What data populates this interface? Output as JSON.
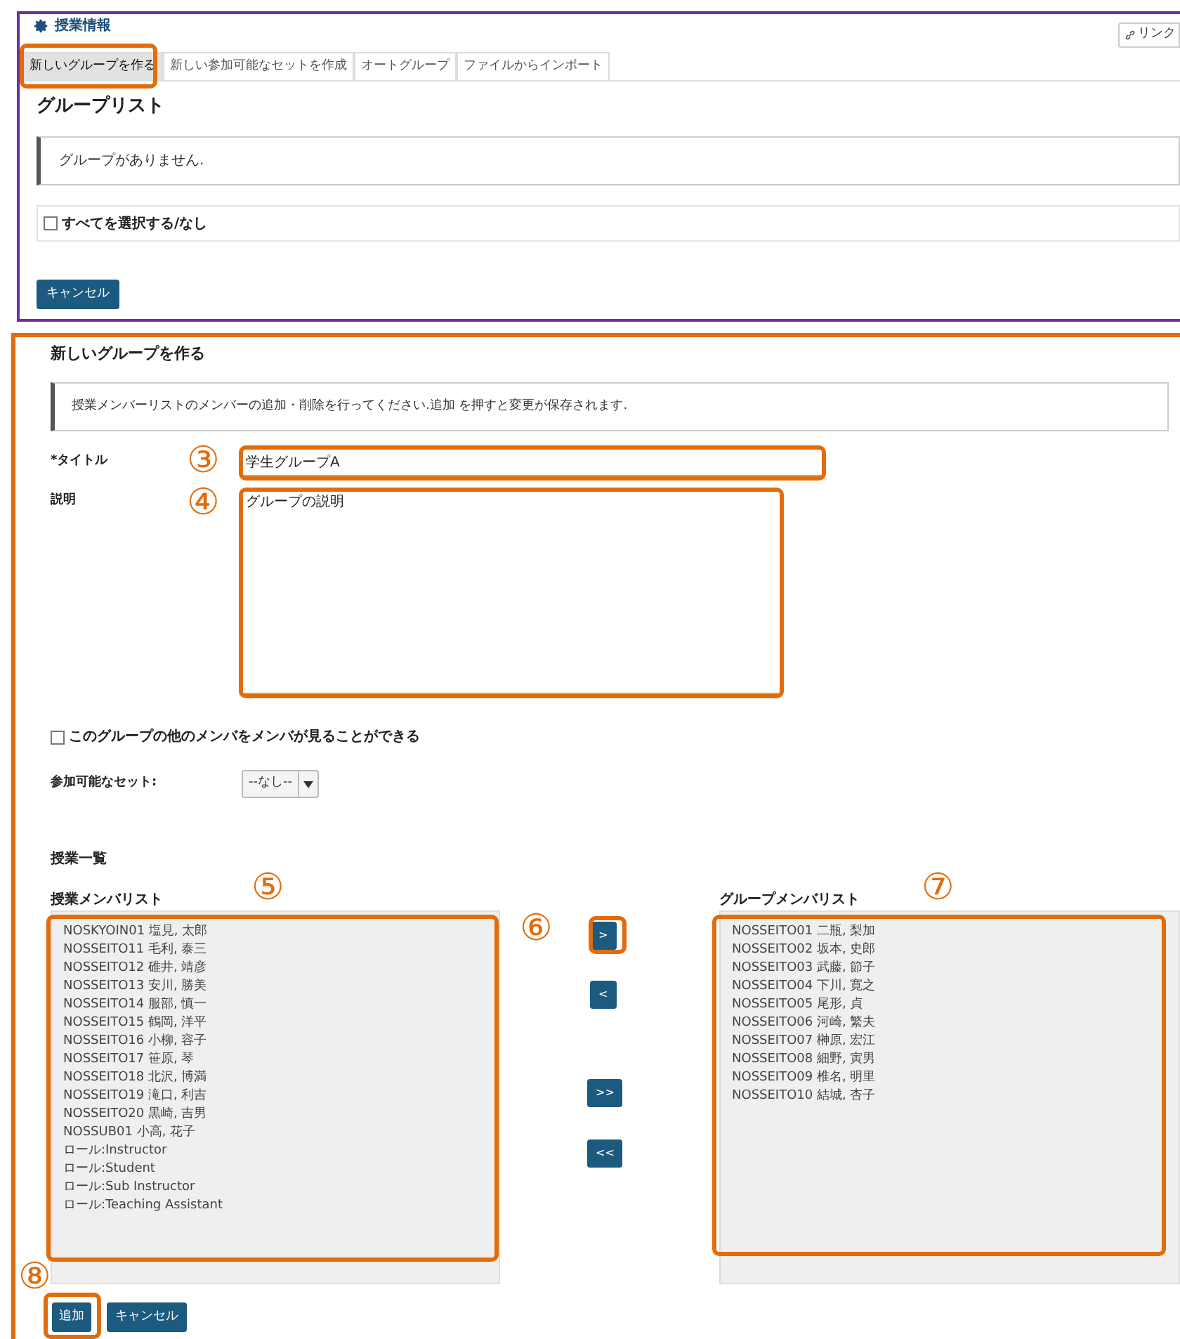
{
  "header": {
    "title": "授業情報",
    "link_button": "リンク"
  },
  "tabs": [
    {
      "label": "新しいグループを作る",
      "selected": true
    },
    {
      "label": "新しい参加可能なセットを作成",
      "selected": false
    },
    {
      "label": "オートグループ",
      "selected": false
    },
    {
      "label": "ファイルからインポート",
      "selected": false
    }
  ],
  "group_list": {
    "heading": "グループリスト",
    "message": "グループがありません.",
    "select_all": {
      "label": "すべてを選択する/なし",
      "checked": false
    },
    "cancel_button": "キャンセル"
  },
  "new_group": {
    "heading": "新しいグループを作る",
    "info": "授業メンバーリストのメンバーの追加・削除を行ってください.追加 を押すと変更が保存されます.",
    "title_label": "*タイトル",
    "title_value": "学生グループA",
    "description_label": "説明",
    "description_value": "グループの説明",
    "visibility": {
      "label": "このグループの他のメンバをメンバが見ることができる",
      "checked": false
    },
    "joinable_set_label": "参加可能なセット:",
    "joinable_set_value": "--なし--",
    "section_heading": "授業一覧",
    "site_members": {
      "heading": "授業メンバリスト",
      "items": [
        "NOSKYOIN01 塩見, 太郎",
        "NOSSEITO11 毛利, 泰三",
        "NOSSEITO12 碓井, 靖彦",
        "NOSSEITO13 安川, 勝美",
        "NOSSEITO14 服部, 慎一",
        "NOSSEITO15 鶴岡, 洋平",
        "NOSSEITO16 小柳, 容子",
        "NOSSEITO17 笹原, 琴",
        "NOSSEITO18 北沢, 博満",
        "NOSSEITO19 滝口, 利吉",
        "NOSSEITO20 黒崎, 吉男",
        "NOSSUB01 小高, 花子",
        "ロール:Instructor",
        "ロール:Student",
        "ロール:Sub Instructor",
        "ロール:Teaching Assistant"
      ]
    },
    "move_buttons": [
      ">",
      "<",
      ">>",
      "<<"
    ],
    "group_members": {
      "heading": "グループメンバリスト",
      "items": [
        "NOSSEITO01 二瓶, 梨加",
        "NOSSEITO02 坂本, 史郎",
        "NOSSEITO03 武藤, 節子",
        "NOSSEITO04 下川, 寛之",
        "NOSSEITO05 尾形, 貞",
        "NOSSEITO06 河崎, 繁夫",
        "NOSSEITO07 榊原, 宏江",
        "NOSSEITO08 細野, 寅男",
        "NOSSEITO09 椎名, 明里",
        "NOSSEITO10 結城, 杏子"
      ]
    },
    "add_button": "追加",
    "cancel_button": "キャンセル"
  },
  "annotations": [
    {
      "label": "③"
    },
    {
      "label": "④"
    },
    {
      "label": "⑤"
    },
    {
      "label": "⑥"
    },
    {
      "label": "⑦"
    },
    {
      "label": "⑧"
    }
  ]
}
